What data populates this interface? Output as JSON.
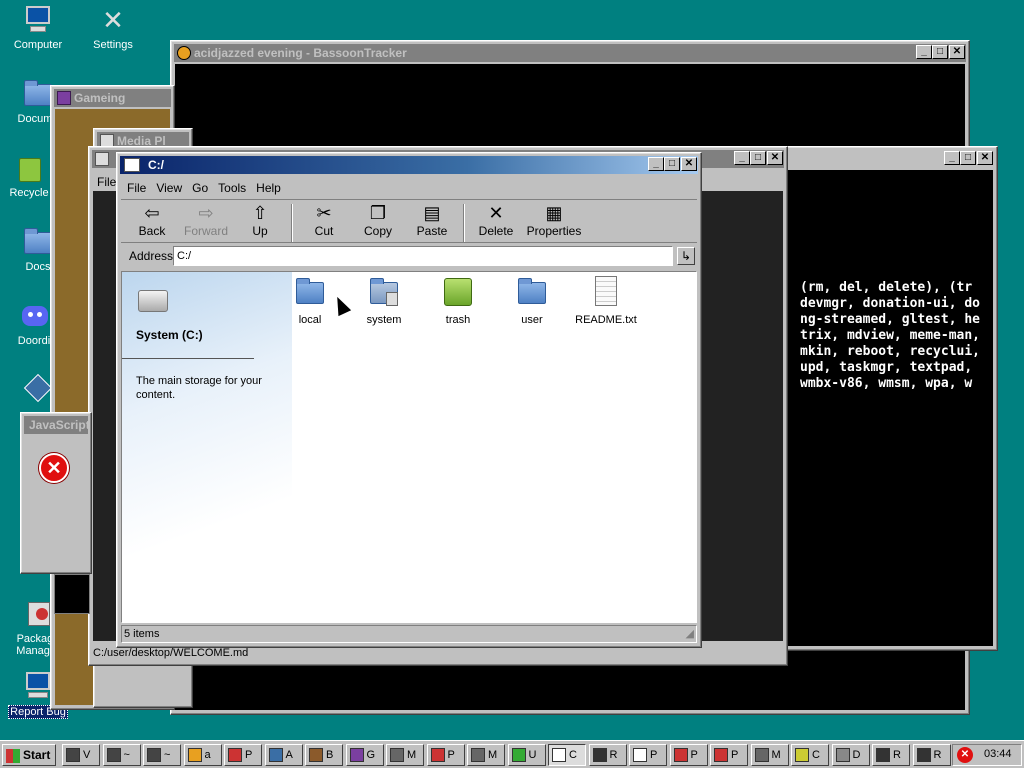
{
  "desktop": {
    "icons": [
      {
        "label": "Computer",
        "icon": "computer-icon"
      },
      {
        "label": "Settings",
        "icon": "tools-icon"
      },
      {
        "label": "Docume",
        "icon": "folder-icon"
      },
      {
        "label": "Recycle",
        "icon": "recycle-bin-icon"
      },
      {
        "label": "Docs",
        "icon": "folder-icon"
      },
      {
        "label": "Doordi",
        "icon": "discord-icon"
      },
      {
        "label": "Package Manager",
        "icon": "package-icon"
      },
      {
        "label": "Report Bug",
        "icon": "bug-report-icon"
      }
    ]
  },
  "windows": {
    "tracker": {
      "title": "acidjazzed evening - BassoonTracker"
    },
    "gameing": {
      "title": "Gameing"
    },
    "mediaplayer": {
      "title": "Media Pl"
    },
    "javascript": {
      "title": "JavaScript"
    },
    "back_file_menu": "File",
    "back_status": "C:/user/desktop/WELCOME.md",
    "terminal": {
      "lines": [
        "(rm, del, delete), (tr",
        "",
        "",
        "",
        "",
        "",
        "devmgr, donation-ui, do",
        "ng-streamed, gltest, he",
        "trix, mdview, meme-man,",
        "mkin, reboot, recyclui,",
        "upd, taskmgr, textpad,",
        "wmbx-v86, wmsm, wpa, w"
      ]
    }
  },
  "explorer": {
    "title": "C:/",
    "menu": [
      "File",
      "View",
      "Go",
      "Tools",
      "Help"
    ],
    "toolbar": [
      {
        "label": "Back",
        "icon": "back-arrow-icon",
        "enabled": true
      },
      {
        "label": "Forward",
        "icon": "forward-arrow-icon",
        "enabled": false
      },
      {
        "label": "Up",
        "icon": "up-folder-icon",
        "enabled": true
      },
      {
        "label": "Cut",
        "icon": "scissors-icon",
        "enabled": true
      },
      {
        "label": "Copy",
        "icon": "copy-icon",
        "enabled": true
      },
      {
        "label": "Paste",
        "icon": "paste-icon",
        "enabled": true
      },
      {
        "label": "Delete",
        "icon": "delete-x-icon",
        "enabled": true
      },
      {
        "label": "Properties",
        "icon": "properties-icon",
        "enabled": true
      }
    ],
    "address_label": "Address",
    "address_value": "C:/",
    "sidebar": {
      "drive_title": "System (C:)",
      "description": "The main storage for your content."
    },
    "items": [
      {
        "name": "local",
        "icon": "folder-icon"
      },
      {
        "name": "system",
        "icon": "system-folder-icon"
      },
      {
        "name": "trash",
        "icon": "trash-icon"
      },
      {
        "name": "user",
        "icon": "folder-icon"
      },
      {
        "name": "README.txt",
        "icon": "text-file-icon"
      }
    ],
    "status": "5 items"
  },
  "taskbar": {
    "start_label": "Start",
    "buttons": [
      "V",
      "~",
      "~",
      "a",
      "P",
      "A",
      "B",
      "G",
      "M",
      "P",
      "M",
      "U",
      "C",
      "R",
      "P",
      "P",
      "P",
      "M",
      "C",
      "D",
      "R",
      "R"
    ],
    "clock": "03:44"
  },
  "colors": {
    "desktop": "#008080",
    "titlebar_active": "#0a246a",
    "titlebar_inactive": "#808080",
    "window_face": "#c0c0c0"
  }
}
